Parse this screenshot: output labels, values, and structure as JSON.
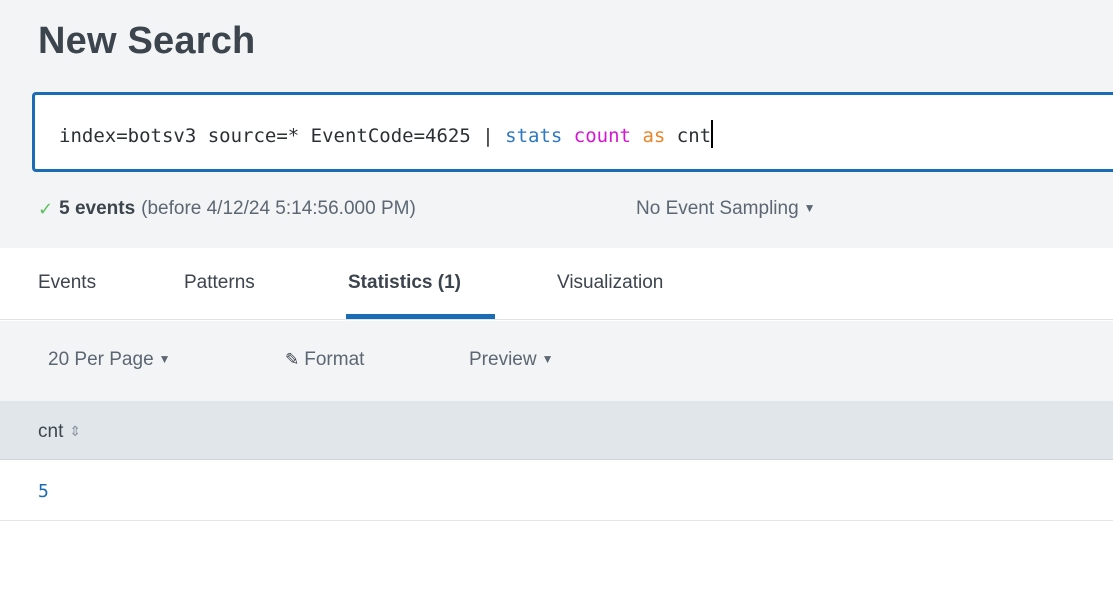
{
  "page": {
    "title": "New Search"
  },
  "search": {
    "tokens": [
      {
        "text": "index=botsv3 source=* EventCode=4625 | ",
        "kind": "plain"
      },
      {
        "text": "stats",
        "kind": "command"
      },
      {
        "text": " ",
        "kind": "plain"
      },
      {
        "text": "count",
        "kind": "function"
      },
      {
        "text": " ",
        "kind": "plain"
      },
      {
        "text": "as",
        "kind": "keyword"
      },
      {
        "text": " cnt",
        "kind": "plain"
      }
    ]
  },
  "status": {
    "check_icon": "✓",
    "events": "5 events",
    "time_range": "(before 4/12/24 5:14:56.000 PM)",
    "sampling": "No Event Sampling"
  },
  "tabs": [
    {
      "label": "Events",
      "active": false
    },
    {
      "label": "Patterns",
      "active": false
    },
    {
      "label": "Statistics (1)",
      "active": true
    },
    {
      "label": "Visualization",
      "active": false
    }
  ],
  "toolbar": {
    "per_page": "20 Per Page",
    "format": "Format",
    "preview": "Preview"
  },
  "table": {
    "columns": [
      "cnt"
    ],
    "rows": [
      [
        "5"
      ]
    ]
  },
  "colors": {
    "accent": "#1a6cb5",
    "command": "#2d78c2",
    "function": "#d416d4",
    "keyword": "#e8862a",
    "success": "#5cc05c"
  }
}
